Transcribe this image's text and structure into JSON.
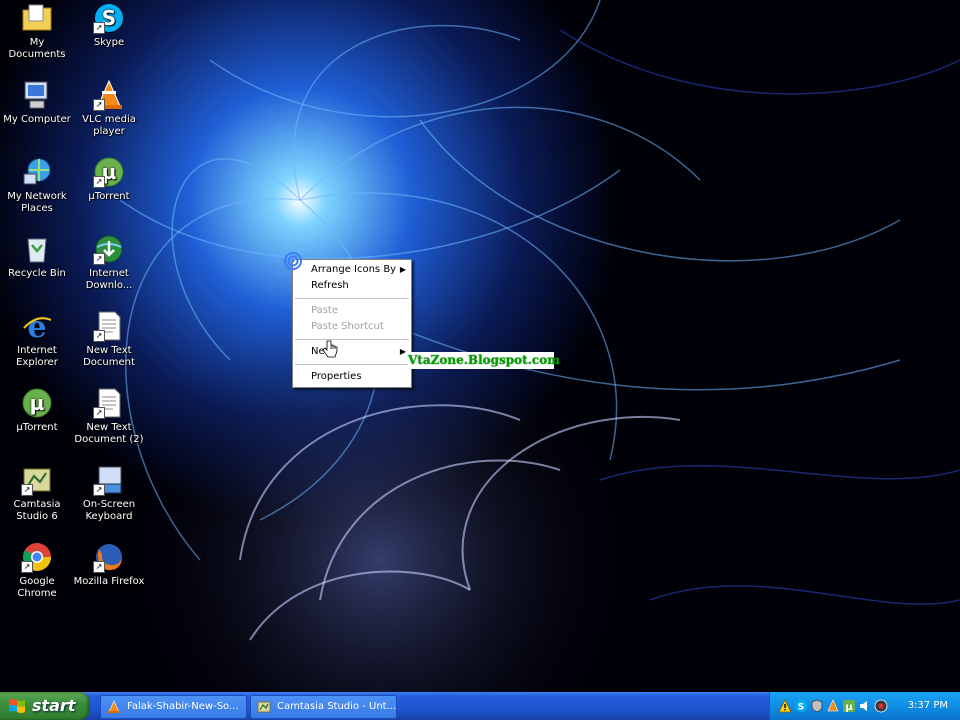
{
  "desktop_icons": [
    {
      "label": "My Documents",
      "icon": "folder-documents-icon"
    },
    {
      "label": "Skype",
      "icon": "skype-icon"
    },
    {
      "label": "My Computer",
      "icon": "computer-icon"
    },
    {
      "label": "VLC media player",
      "icon": "vlc-cone-icon"
    },
    {
      "label": "My Network Places",
      "icon": "network-icon"
    },
    {
      "label": "µTorrent",
      "icon": "utorrent-icon"
    },
    {
      "label": "Recycle Bin",
      "icon": "recycle-bin-icon"
    },
    {
      "label": "Internet Downlo...",
      "icon": "internet-download-icon"
    },
    {
      "label": "Internet Explorer",
      "icon": "internet-explorer-icon"
    },
    {
      "label": "New Text Document",
      "icon": "text-document-icon"
    },
    {
      "label": "µTorrent",
      "icon": "utorrent-icon"
    },
    {
      "label": "New Text Document (2)",
      "icon": "text-document-icon"
    },
    {
      "label": "Camtasia Studio 6",
      "icon": "camtasia-icon"
    },
    {
      "label": "On-Screen Keyboard",
      "icon": "keyboard-icon"
    },
    {
      "label": "Google Chrome",
      "icon": "chrome-icon"
    },
    {
      "label": "Mozilla Firefox",
      "icon": "firefox-icon"
    }
  ],
  "context_menu": {
    "arrange": "Arrange Icons By",
    "refresh": "Refresh",
    "paste": "Paste",
    "paste_shortcut": "Paste Shortcut",
    "new": "New",
    "properties": "Properties"
  },
  "watermark": "VtaZone.Blogspot.com",
  "taskbar": {
    "start_label": "start",
    "tasks": [
      {
        "label": "Falak-Shabir-New-So...",
        "icon": "vlc-cone-icon"
      },
      {
        "label": "Camtasia Studio - Unt...",
        "icon": "camtasia-icon"
      }
    ],
    "clock": "3:37 PM"
  },
  "colors": {
    "taskbar_blue": "#245edb",
    "start_green": "#3c8f3b",
    "tray_blue": "#0f8ae0",
    "watermark_green": "#00a000"
  }
}
